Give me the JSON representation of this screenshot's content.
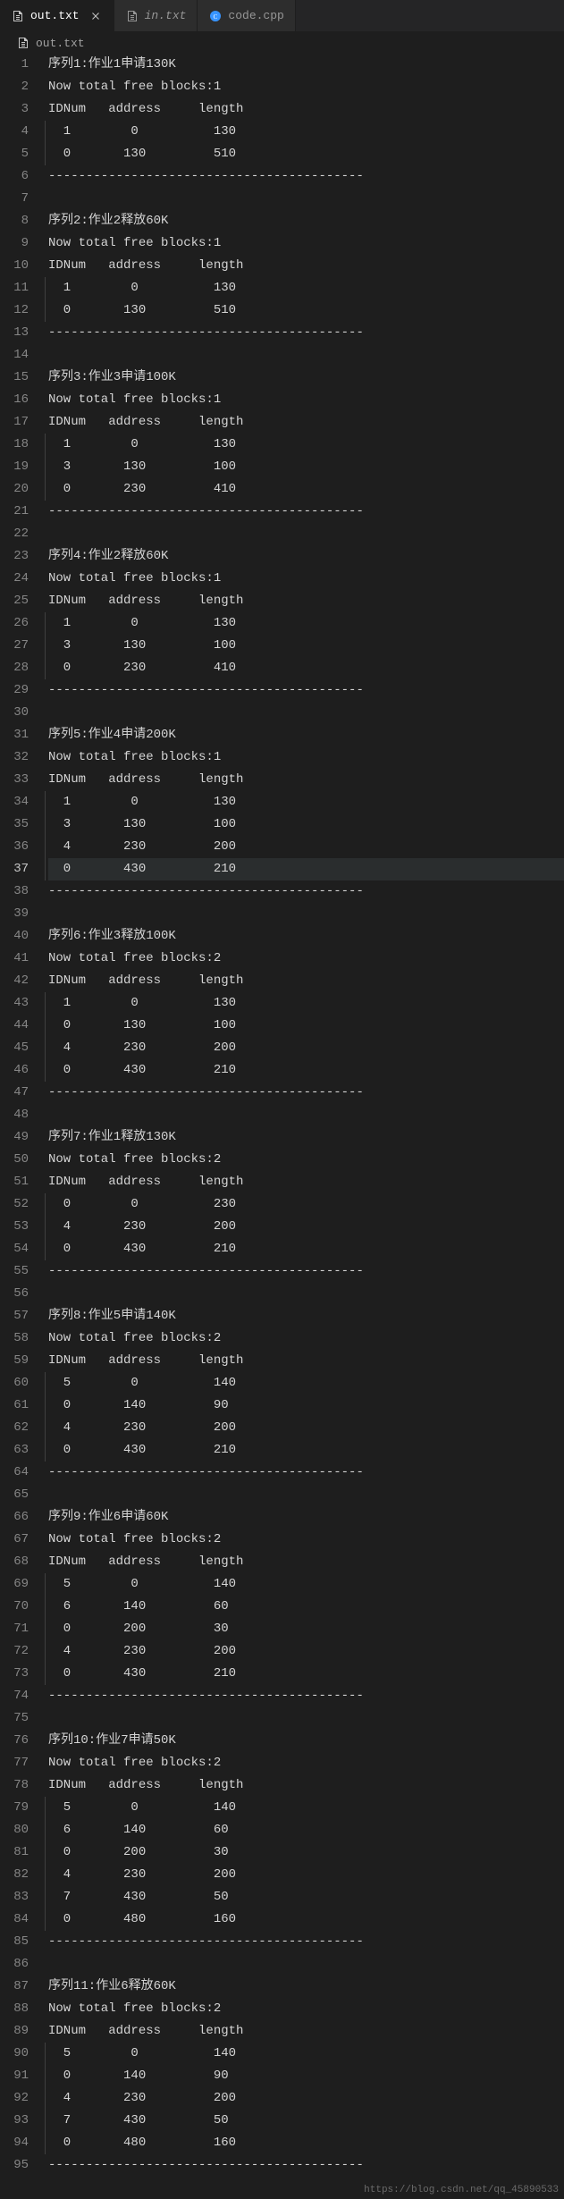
{
  "tabs": [
    {
      "label": "out.txt",
      "icon": "file-lines-icon",
      "active": true,
      "closable": true
    },
    {
      "label": "in.txt",
      "icon": "file-lines-icon",
      "active": false,
      "closable": false,
      "italic": true
    },
    {
      "label": "code.cpp",
      "icon": "cpp-file-icon",
      "active": false,
      "closable": false
    }
  ],
  "breadcrumb": {
    "icon": "file-lines-icon",
    "label": "out.txt"
  },
  "active_line": 37,
  "lines": [
    "序列1:作业1申请130K",
    "Now total free blocks:1",
    "IDNum   address     length",
    "  1        0          130",
    "  0       130         510",
    "------------------------------------------",
    "",
    "序列2:作业2释放60K",
    "Now total free blocks:1",
    "IDNum   address     length",
    "  1        0          130",
    "  0       130         510",
    "------------------------------------------",
    "",
    "序列3:作业3申请100K",
    "Now total free blocks:1",
    "IDNum   address     length",
    "  1        0          130",
    "  3       130         100",
    "  0       230         410",
    "------------------------------------------",
    "",
    "序列4:作业2释放60K",
    "Now total free blocks:1",
    "IDNum   address     length",
    "  1        0          130",
    "  3       130         100",
    "  0       230         410",
    "------------------------------------------",
    "",
    "序列5:作业4申请200K",
    "Now total free blocks:1",
    "IDNum   address     length",
    "  1        0          130",
    "  3       130         100",
    "  4       230         200",
    "  0       430         210",
    "------------------------------------------",
    "",
    "序列6:作业3释放100K",
    "Now total free blocks:2",
    "IDNum   address     length",
    "  1        0          130",
    "  0       130         100",
    "  4       230         200",
    "  0       430         210",
    "------------------------------------------",
    "",
    "序列7:作业1释放130K",
    "Now total free blocks:2",
    "IDNum   address     length",
    "  0        0          230",
    "  4       230         200",
    "  0       430         210",
    "------------------------------------------",
    "",
    "序列8:作业5申请140K",
    "Now total free blocks:2",
    "IDNum   address     length",
    "  5        0          140",
    "  0       140         90",
    "  4       230         200",
    "  0       430         210",
    "------------------------------------------",
    "",
    "序列9:作业6申请60K",
    "Now total free blocks:2",
    "IDNum   address     length",
    "  5        0          140",
    "  6       140         60",
    "  0       200         30",
    "  4       230         200",
    "  0       430         210",
    "------------------------------------------",
    "",
    "序列10:作业7申请50K",
    "Now total free blocks:2",
    "IDNum   address     length",
    "  5        0          140",
    "  6       140         60",
    "  0       200         30",
    "  4       230         200",
    "  7       430         50",
    "  0       480         160",
    "------------------------------------------",
    "",
    "序列11:作业6释放60K",
    "Now total free blocks:2",
    "IDNum   address     length",
    "  5        0          140",
    "  0       140         90",
    "  4       230         200",
    "  7       430         50",
    "  0       480         160",
    "------------------------------------------"
  ],
  "watermark": "https://blog.csdn.net/qq_45890533",
  "colors": {
    "bg": "#1e1e1e",
    "tab_bg": "#2d2d2d",
    "tab_active_bg": "#1e1e1e",
    "text": "#d4d4d4",
    "gutter": "#858585",
    "highlight": "#2a2d2e",
    "cpp_icon": "#3794ff"
  }
}
